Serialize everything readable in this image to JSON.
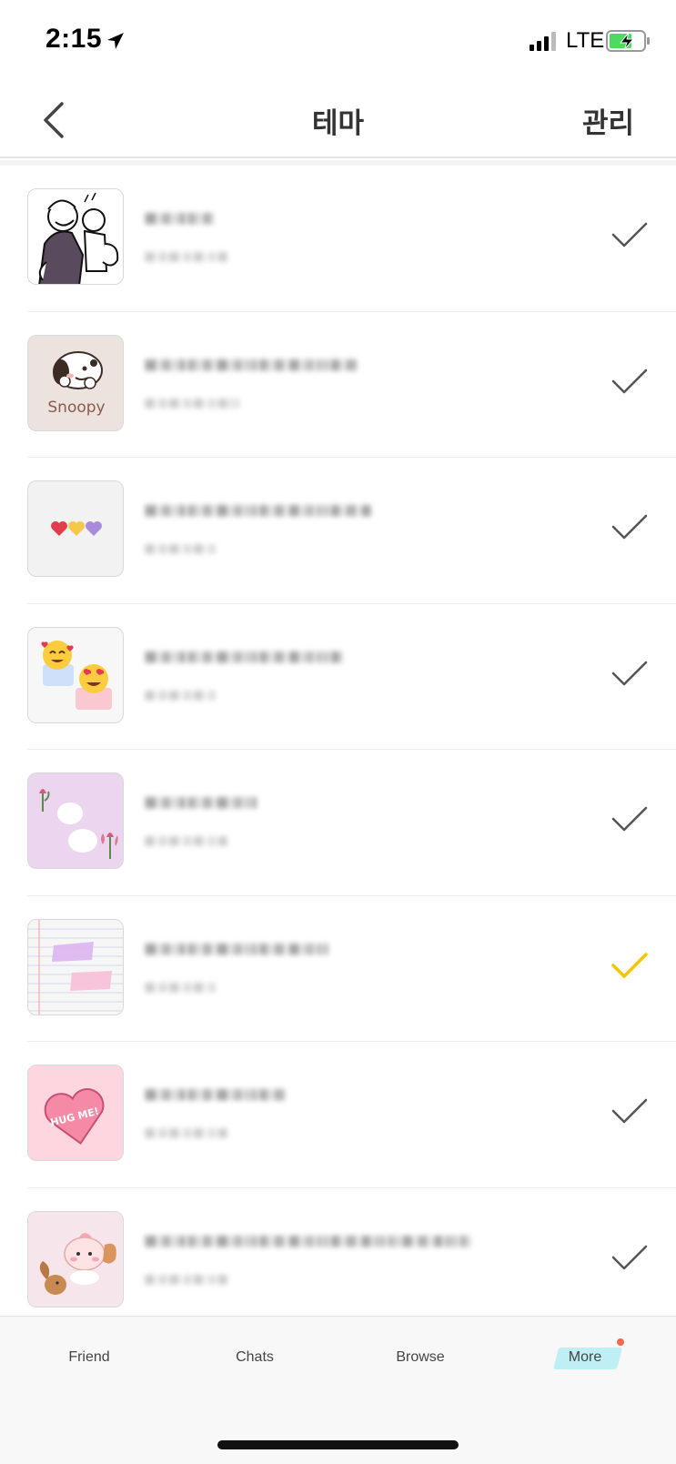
{
  "status_bar": {
    "time": "2:15",
    "network": "LTE",
    "battery_color": "#4cd964"
  },
  "header": {
    "title": "테마",
    "manage_label": "관리"
  },
  "themes": [
    {
      "name": "■■■■■",
      "subtitle": "■■■■■■■",
      "selected": false,
      "thumbnail": "popeye-comic-icon"
    },
    {
      "name": "■■■■■■■■■■■■■■■",
      "subtitle": "■■■■■■■■",
      "selected": false,
      "thumbnail": "snoopy-icon",
      "thumbnail_text": "Snoopy"
    },
    {
      "name": "■■■■■■■■■■■■■■■■",
      "subtitle": "■■■■■■",
      "selected": false,
      "thumbnail": "hearts-icon"
    },
    {
      "name": "■■■■■■■■■■■■■■",
      "subtitle": "■■■■■■",
      "selected": false,
      "thumbnail": "emoji-love-icon"
    },
    {
      "name": "■■■■■■■■",
      "subtitle": "■■■■■■■",
      "selected": false,
      "thumbnail": "tulip-bubbles-icon"
    },
    {
      "name": "■■■■■■■■■■■■■",
      "subtitle": "■■■■■■",
      "selected": true,
      "thumbnail": "notebook-paper-icon"
    },
    {
      "name": "■■■■■■■■■■",
      "subtitle": "■■■■■■■",
      "selected": false,
      "thumbnail": "hug-me-heart-icon",
      "thumbnail_text": "HUG ME!"
    },
    {
      "name": "■■■■■■■■■■■■■■■■■■■■■■■",
      "subtitle": "■■■■■■■",
      "selected": false,
      "thumbnail": "peach-squirrel-icon"
    }
  ],
  "colors": {
    "check_default": "#555555",
    "check_selected": "#f7c600",
    "more_highlight": "#bfeff4",
    "badge_dot": "#f26a4b"
  },
  "tabs": [
    {
      "label": "Friend"
    },
    {
      "label": "Chats"
    },
    {
      "label": "Browse"
    },
    {
      "label": "More",
      "active": true
    }
  ]
}
